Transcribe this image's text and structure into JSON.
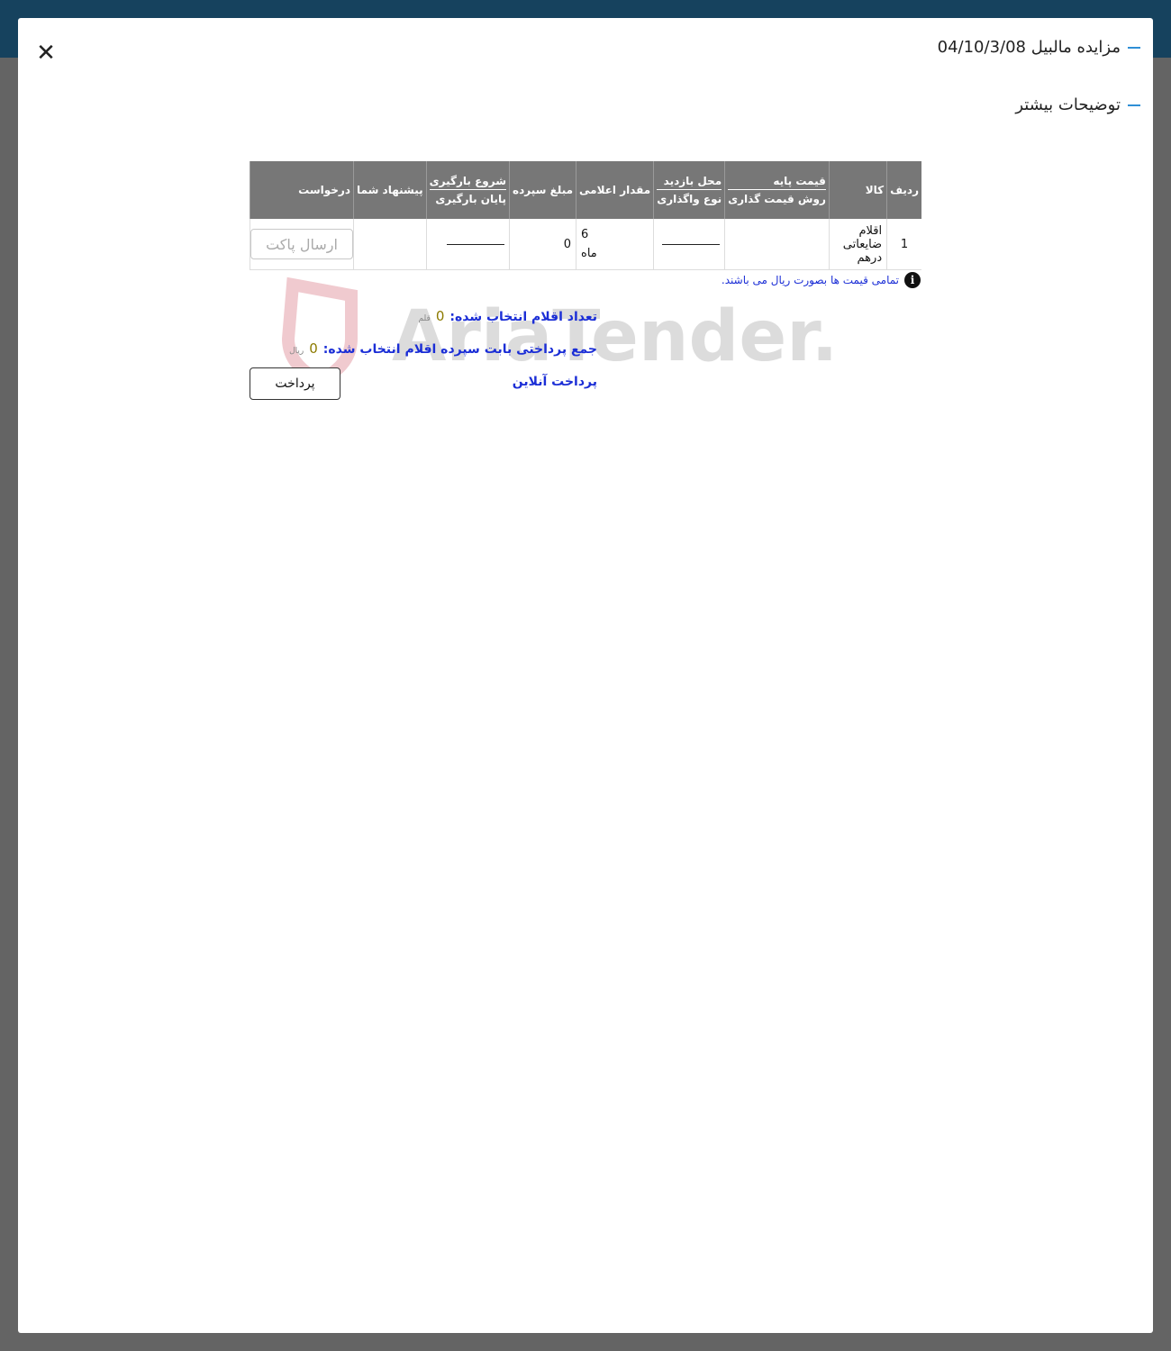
{
  "modal": {
    "title": "مزایده مالبیل 04/10/3/08",
    "section_more": "توضیحات بیشتر",
    "close_symbol": "✕"
  },
  "table": {
    "headers": {
      "row_num": "ردیف",
      "item": "کالا",
      "base_price": "قیمت پایه",
      "pricing_method": "روش قیمت گذاری",
      "visit_place": "محل بازدید",
      "assignment_type": "نوع واگذاری",
      "declared_amount": "مقدار اعلامی",
      "deposit_amount": "مبلغ سپرده",
      "loading_start": "شروع بارگیری",
      "loading_end": "پایان بارگیری",
      "your_offer": "پیشنهاد شما",
      "request": "درخواست"
    },
    "rows": [
      {
        "row_num": "1",
        "item": "اقلام ضایعاتی درهم",
        "base_price": "",
        "visit_place": "",
        "declared_amount": "6",
        "declared_unit": "ماه",
        "deposit_amount": "0",
        "loading": "",
        "your_offer": "",
        "request_button": "ارسال پاکت"
      }
    ]
  },
  "note": {
    "icon": "info-icon",
    "text": "تمامی قیمت ها بصورت ریال می باشند."
  },
  "watermark": {
    "text": "AriaTender.neT"
  },
  "summary": {
    "selected_count_label": "تعداد اقلام انتخاب شده:",
    "selected_count_value": "0",
    "selected_count_unit": "قلم",
    "total_payment_label": "جمع پرداختی بابت سپرده اقلام انتخاب شده:",
    "total_payment_value": "0",
    "total_payment_unit": "ریال",
    "online_payment_link": "پرداخت آنلاین",
    "pay_button": "پرداخت"
  },
  "colors": {
    "accent": "#2f8fd6",
    "link_blue": "#1b2ed6",
    "header_gray": "#777777",
    "topbar": "#16425e",
    "backdrop": "#646464"
  }
}
